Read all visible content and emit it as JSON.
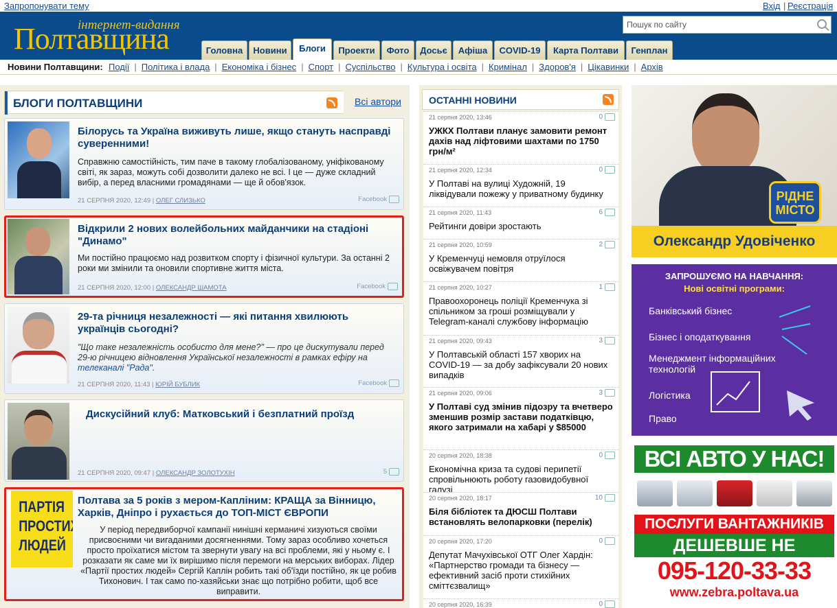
{
  "topbar": {
    "suggest": "Запропонувати тему",
    "login": "Вхід",
    "sep": "|",
    "register": "Реєстрація"
  },
  "logo": {
    "small": "інтернет-видання",
    "big": "Полтавщина"
  },
  "search": {
    "placeholder": "Пошук по сайту"
  },
  "tabs": [
    "Головна",
    "Новини",
    "Блоги",
    "Проекти",
    "Фото",
    "Досьє",
    "Афіша",
    "COVID-19",
    "Карта Полтави",
    "Генплан"
  ],
  "active_tab": "Блоги",
  "subnav": {
    "title": "Новини Полтавщини:",
    "items": [
      "Події",
      "Політика і влада",
      "Економіка і бізнес",
      "Спорт",
      "Суспільство",
      "Культура і освіта",
      "Кримінал",
      "Здоров'я",
      "Цікавинки",
      "Архів"
    ]
  },
  "blogs": {
    "title": "БЛОГИ ПОЛТАВЩИНИ",
    "all_authors": "Всі автори",
    "posts": [
      {
        "title": "Білорусь та Україна виживуть лише, якщо стануть насправді суверенними!",
        "text": "Справжню самостійність, тим паче в такому глобалізованому, уніфікованому світі, як зараз, можуть собі дозволити далеко не всі. І це — дуже складний вибір, а перед власними громадянами — ще й обов'язок.",
        "date": "21 серпня 2020, 12:49",
        "author": "Олег Слизько",
        "share": "Facebook"
      },
      {
        "title": "Відкрили 2 нових волейбольних майданчики на стадіоні \"Динамо\"",
        "text": "Ми постійно працюємо над розвитком спорту і фізичної культури. За останні 2 роки ми змінили та оновили спортивне життя міста.",
        "date": "21 серпня 2020, 12:00",
        "author": "Олександр Шамота",
        "share": "Facebook"
      },
      {
        "title": "29-та річниця незалежності — які питання хвилюють українців сьогодні?",
        "text": "\"Що таке незалежність особисто для мене?\" — про це дискутували перед 29-ю річницею відновлення Української незалежності в рамках ефіру на",
        "link": "телеканалі \"Рада\"",
        "text_end": ".",
        "date": "21 серпня 2020, 11:43",
        "author": "Юрій Бублик",
        "share": "Facebook"
      },
      {
        "title": "Дискусійний клуб: Матковський і безплатний проїзд",
        "text": "",
        "date": "21 серпня 2020, 09:47",
        "author": "Олександр Золотухін",
        "comments": "5"
      },
      {
        "title": "Полтава за 5 років з мером-Капліним: КРАЩА за Вінницю, Харків, Дніпро і рухається до ТОП-МІСТ ЄВРОПИ",
        "text": "У період передвиборчої кампанії нинішні керманичі хизуються своїми присвоєними чи вигаданими досягненнями. Тому зараз особливо хочеться просто проїхатися містом та звернути увагу на всі проблеми, які у ньому є. І розказати як саме ми їх вирішимо після перемоги на мерських виборах. Лідер «Партії простих людей» Сергій Каплін робить такі об'їзди постійно, як це робив Тихонович. І так само по-хазяйськи знає що потрібно робити, щоб все виправити.",
        "photo_text": "ПАРТІЯ ПРОСТИХ ЛЮДЕЙ"
      }
    ]
  },
  "news": {
    "title": "ОСТАННІ НОВИНИ",
    "items": [
      {
        "date": "21 серпня 2020, 13:46",
        "comments": "0",
        "title": "УЖКХ Полтави планує замовити ремонт дахів над ліфтовими шахтами по 1750 грн/м²",
        "bold": true
      },
      {
        "date": "21 серпня 2020, 12:34",
        "comments": "0",
        "title": "У Полтаві на вулиці Художній, 19 ліквідували пожежу у приватному будинку",
        "bold": false
      },
      {
        "date": "21 серпня 2020, 11:43",
        "comments": "6",
        "title": "Рейтинги довіри зростають",
        "bold": false
      },
      {
        "date": "21 серпня 2020, 10:59",
        "comments": "2",
        "title": "У Кременчуці немовля отруїлося освіжувачем повітря",
        "bold": false
      },
      {
        "date": "21 серпня 2020, 10:27",
        "comments": "1",
        "title": "Правоохоронець поліції Кременчука зі спільником за гроші розміщували у Telegram-каналі службову інформацію",
        "bold": false
      },
      {
        "date": "21 серпня 2020, 09:43",
        "comments": "3",
        "title": "У Полтавській області 157 хворих на COVID-19 — за добу зафіксували 20 нових випадків",
        "bold": false
      },
      {
        "date": "21 серпня 2020, 09:06",
        "comments": "3",
        "title": "У Полтаві суд змінив підозру та вчетверо зменшив розмір застави податківцю, якого затримали на хабарі у $85000",
        "bold": true
      },
      {
        "date": "20 серпня 2020, 18:38",
        "comments": "0",
        "title": "Економічна криза та судові перипетії спровільнюють роботу газовидобувної галузі",
        "bold": false
      },
      {
        "date": "20 серпня 2020, 18:17",
        "comments": "10",
        "title": "Біля бібліотек та ДЮСШ Полтави встановлять велопарковки (перелік)",
        "bold": true
      },
      {
        "date": "20 серпня 2020, 17:20",
        "comments": "0",
        "title": "Депутат Мачухівської ОТГ Олег Хардін: «Партнерство громади та бізнесу — ефективний засіб проти стихійних сміттєзвалищ»",
        "bold": false
      },
      {
        "date": "20 серпня 2020, 16:39",
        "comments": "0",
        "title": "",
        "bold": false
      }
    ]
  },
  "ads": {
    "ad1": {
      "name": "Олександр Удовіченко",
      "badge": "РІДНЕ МІСТО"
    },
    "ad2": {
      "h1": "ЗАПРОШУЄМО НА НАВЧАННЯ:",
      "h2": "Нові освітні програми:",
      "items": [
        "Банківський бізнес",
        "Бізнес і оподаткування",
        "Менеджмент інформаційних технологій",
        "Логістика",
        "Право"
      ]
    },
    "ad3": {
      "l1": "ВСІ АВТО У НАС!",
      "l2": "ПОСЛУГИ ВАНТАЖНИКІВ",
      "l3": "ДЕШЕВШЕ НЕ ЗНАЙТИ!",
      "l4": "095-120-33-33",
      "l5": "www.zebra.poltava.ua"
    }
  },
  "colors": {
    "brand_blue": "#0a4b8c",
    "logo_yellow": "#f5c400",
    "highlight": "#e0201b"
  }
}
